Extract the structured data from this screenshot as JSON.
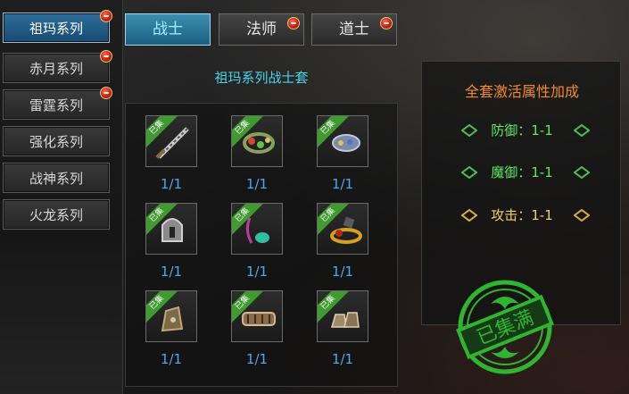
{
  "sidebar": {
    "items": [
      {
        "label": "祖玛系列",
        "active": true,
        "badge": true
      },
      {
        "label": "赤月系列",
        "active": false,
        "badge": true
      },
      {
        "label": "雷霆系列",
        "active": false,
        "badge": true
      },
      {
        "label": "强化系列",
        "active": false,
        "badge": false
      },
      {
        "label": "战神系列",
        "active": false,
        "badge": false
      },
      {
        "label": "火龙系列",
        "active": false,
        "badge": false
      }
    ]
  },
  "tabs": [
    {
      "label": "战士",
      "active": true,
      "badge": false
    },
    {
      "label": "法师",
      "active": false,
      "badge": true
    },
    {
      "label": "道士",
      "active": false,
      "badge": true
    }
  ],
  "set": {
    "title": "祖玛系列战士套",
    "collected_tag": "已集",
    "items": [
      {
        "icon": "sword-icon",
        "count": "1/1"
      },
      {
        "icon": "necklace-icon",
        "count": "1/1"
      },
      {
        "icon": "bracelet-icon",
        "count": "1/1"
      },
      {
        "icon": "helmet-icon",
        "count": "1/1"
      },
      {
        "icon": "medal-icon",
        "count": "1/1"
      },
      {
        "icon": "ring-icon",
        "count": "1/1"
      },
      {
        "icon": "belt-icon",
        "count": "1/1"
      },
      {
        "icon": "bracelet-icon",
        "count": "1/1"
      },
      {
        "icon": "boots-icon",
        "count": "1/1"
      }
    ]
  },
  "bonus": {
    "title": "全套激活属性加成",
    "stats": [
      {
        "label": "防御：1-1",
        "color": "#5ee85e"
      },
      {
        "label": "魔御：1-1",
        "color": "#5ee85e"
      },
      {
        "label": "攻击：1-1",
        "color": "#f0d060"
      }
    ]
  },
  "stamp": {
    "text": "已集满",
    "color": "#2fb52f"
  }
}
